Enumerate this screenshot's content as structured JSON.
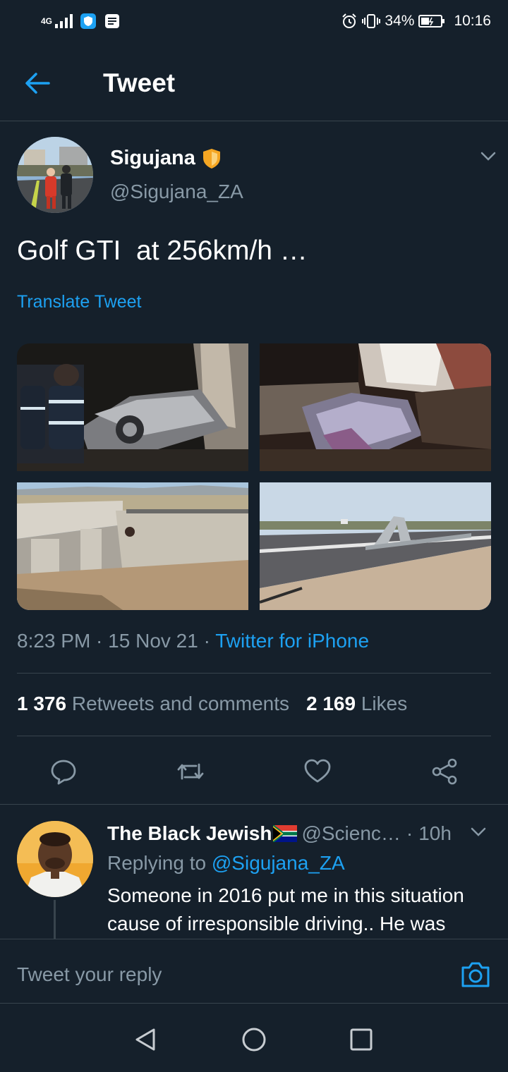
{
  "status_bar": {
    "network": "4G",
    "battery": "34%",
    "time": "10:16"
  },
  "header": {
    "title": "Tweet",
    "back_icon": "arrow-left-icon"
  },
  "tweet": {
    "author": {
      "name": "Sigujana",
      "handle": "@Sigujana_ZA",
      "badge": "shield-icon"
    },
    "text": "Golf GTI  at 256km/h …",
    "translate_label": "Translate Tweet",
    "time": "8:23 PM",
    "date": "15 Nov 21",
    "sep": " · ",
    "client": "Twitter for iPhone",
    "retweets_count": "1 376",
    "retweets_label": "Retweets and comments",
    "likes_count": "2 169",
    "likes_label": "Likes"
  },
  "actions": [
    "comment-icon",
    "retweet-icon",
    "like-icon",
    "share-icon"
  ],
  "reply": {
    "name": "The Black Jewish",
    "handle": "@Scienc…",
    "dot": "·",
    "time": "10h",
    "replying_label": "Replying to",
    "replying_to": "@Sigujana_ZA",
    "text": "Someone in 2016 put me in this situation cause of irresponsible driving.. He was"
  },
  "composer": {
    "placeholder": "Tweet your reply"
  },
  "colors": {
    "background": "#15202b",
    "accent": "#1da1f2",
    "secondary_text": "#8899a6",
    "divider": "#38444d",
    "badge": "#f5a623"
  }
}
